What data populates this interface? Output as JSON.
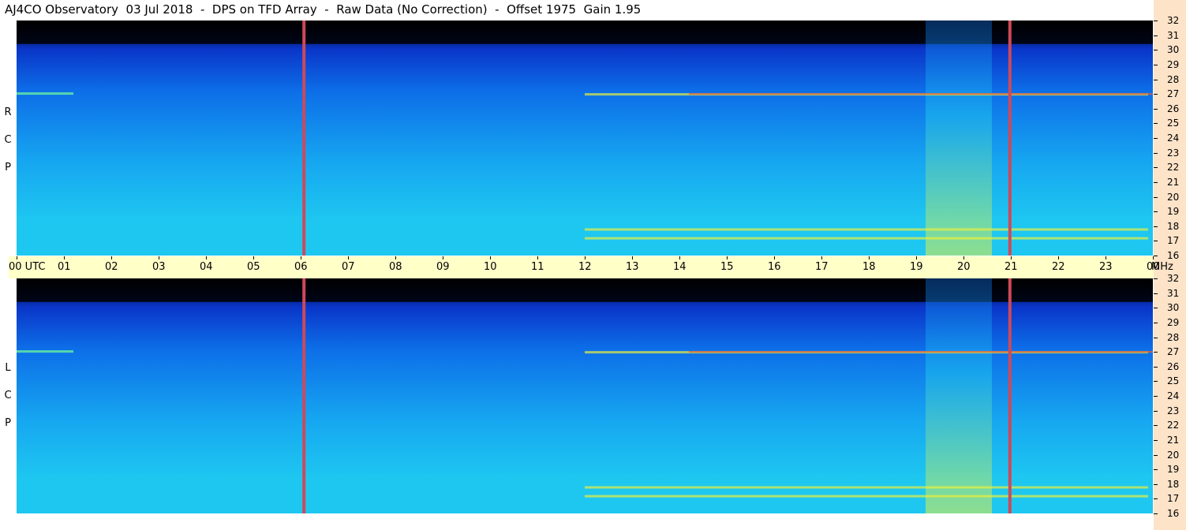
{
  "header": {
    "title": "AJ4CO Observatory  03 Jul 2018  -  DPS on TFD Array  -  Raw Data (No Correction)  -  Offset 1975  Gain 1.95"
  },
  "side_labels": {
    "top": [
      "R",
      "C",
      "P"
    ],
    "bottom": [
      "L",
      "C",
      "P"
    ]
  },
  "colors": {
    "colormap": [
      "#000000",
      "#001b6e",
      "#0a35c8",
      "#0d6ee8",
      "#16a6f0",
      "#1ec7f0",
      "#68f0a0",
      "#e8f040",
      "#e06040"
    ],
    "interference_line": "#d04858",
    "axis_background": "#ffffc8",
    "right_strip": "#fde3c8"
  },
  "chart_data": {
    "type": "heatmap",
    "title": "AJ4CO Observatory  03 Jul 2018  -  DPS on TFD Array  -  Raw Data (No Correction)  -  Offset 1975  Gain 1.95",
    "x_axis": {
      "unit": "UTC",
      "ticks": [
        "00",
        "01",
        "02",
        "03",
        "04",
        "05",
        "06",
        "07",
        "08",
        "09",
        "10",
        "11",
        "12",
        "13",
        "14",
        "15",
        "16",
        "17",
        "18",
        "19",
        "20",
        "21",
        "22",
        "23",
        "00"
      ],
      "first_label": "00  UTC",
      "range_hours": [
        0,
        24
      ]
    },
    "y_axis": {
      "unit": "MHz",
      "ticks": [
        32,
        31,
        30,
        29,
        28,
        27,
        26,
        25,
        24,
        23,
        22,
        21,
        20,
        19,
        18,
        17,
        16
      ],
      "range": [
        16,
        32
      ]
    },
    "panels": [
      {
        "name": "RCP",
        "label": "R C P"
      },
      {
        "name": "LCP",
        "label": "L C P"
      }
    ],
    "interference_lines_utc": [
      6.07,
      20.98
    ],
    "bright_emission_hours_utc": [
      [
        19.2,
        20.6
      ]
    ],
    "persistent_band_mhz": [
      17.2,
      17.8,
      27.0
    ]
  }
}
